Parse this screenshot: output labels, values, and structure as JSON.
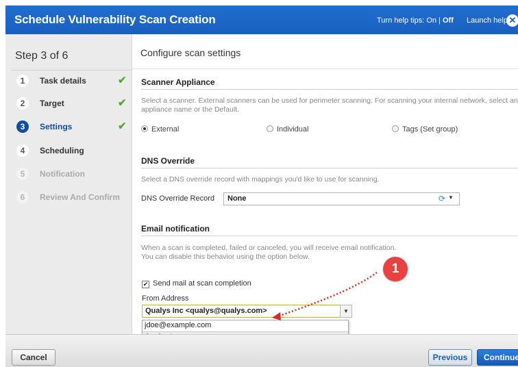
{
  "window": {
    "title": "Schedule Vulnerability Scan Creation",
    "help_tips_prefix": "Turn help tips: On | ",
    "help_tips_off": "Off",
    "launch_help": "Launch help",
    "close_glyph": "✕"
  },
  "wizard": {
    "step_header": "Step 3 of 6",
    "steps": [
      {
        "num": "1",
        "label": "Task details",
        "state": "done"
      },
      {
        "num": "2",
        "label": "Target",
        "state": "done"
      },
      {
        "num": "3",
        "label": "Settings",
        "state": "active"
      },
      {
        "num": "4",
        "label": "Scheduling",
        "state": "pending"
      },
      {
        "num": "5",
        "label": "Notification",
        "state": "disabled"
      },
      {
        "num": "6",
        "label": "Review And Confirm",
        "state": "disabled"
      }
    ],
    "check_glyph": "✔"
  },
  "main": {
    "page_title": "Configure scan settings",
    "scanner": {
      "heading": "Scanner Appliance",
      "description": "Select a scanner. External scanners can be used for perimeter scanning. For scanning your internal network, select an appliance name or the Default.",
      "options": [
        "External",
        "Individual",
        "Tags (Set group)"
      ],
      "selected": "External"
    },
    "dns": {
      "heading": "DNS Override",
      "description": "Select a DNS override record with mappings you'd like to use for scanning.",
      "field_label": "DNS Override Record",
      "value": "None"
    },
    "email": {
      "heading": "Email notification",
      "description_line1": "When a scan is completed, failed or canceled, you will receive email notification.",
      "description_line2": "You can disable this behavior using the option below.",
      "checkbox_label": "Send mail at scan completion",
      "checkbox_checked": true,
      "from_label": "From Address",
      "from_value": "Qualys Inc <qualys@qualys.com>",
      "dropdown_options": [
        "jdoe@example.com",
        "Qualys Inc"
      ]
    }
  },
  "footer": {
    "cancel": "Cancel",
    "previous": "Previous",
    "continue": "Continue"
  },
  "annotation": {
    "badge": "1",
    "color": "#e94040"
  },
  "colors": {
    "title_bar": "#1a5fbf",
    "active_step": "#0e4e9b",
    "done_check": "#54a82e"
  }
}
